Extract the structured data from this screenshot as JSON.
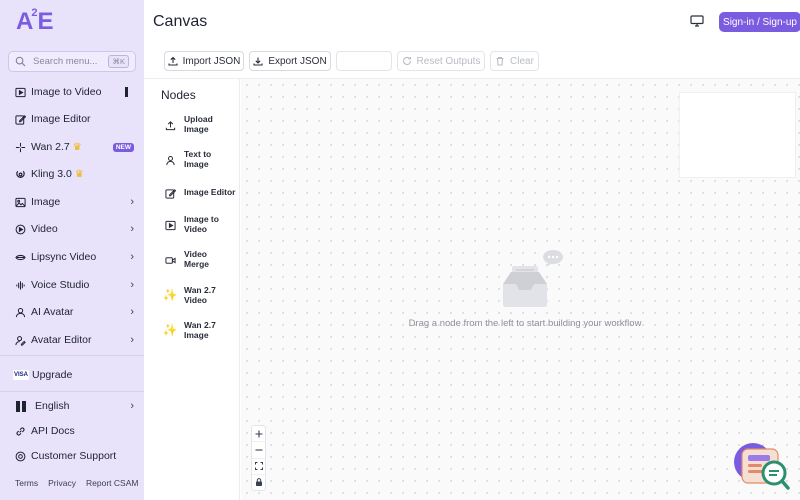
{
  "app": {
    "logo_text": "A",
    "logo_sup": "2",
    "logo_tail": "E",
    "page_title": "Canvas",
    "sign_label": "Sign-in / Sign-up"
  },
  "search": {
    "placeholder": "Search menu...",
    "shortcut": "⌘K"
  },
  "sidebar": {
    "items": [
      {
        "label": "Image to Video",
        "icon": "image-to-video-icon"
      },
      {
        "label": "Image Editor",
        "icon": "edit-icon"
      },
      {
        "label": "Wan 2.7",
        "icon": "wan-icon",
        "badge": "NEW",
        "crown": true
      },
      {
        "label": "Kling 3.0",
        "icon": "kling-icon",
        "crown": true
      },
      {
        "label": "Image",
        "icon": "image-icon",
        "chevron": true
      },
      {
        "label": "Video",
        "icon": "video-icon",
        "chevron": true
      },
      {
        "label": "Lipsync Video",
        "icon": "lipsync-icon",
        "chevron": true
      },
      {
        "label": "Voice Studio",
        "icon": "voice-icon",
        "chevron": true
      },
      {
        "label": "AI Avatar",
        "icon": "avatar-icon",
        "chevron": true
      },
      {
        "label": "Avatar Editor",
        "icon": "avatar-editor-icon",
        "chevron": true
      }
    ],
    "upgrade": {
      "label": "Upgrade",
      "card_text": "VISA"
    },
    "language": {
      "label": "English"
    },
    "api_docs": {
      "label": "API Docs"
    },
    "support": {
      "label": "Customer Support"
    },
    "footer": [
      "Terms",
      "Privacy",
      "Report CSAM"
    ]
  },
  "toolbar": {
    "import_label": "Import JSON",
    "export_label": "Export JSON",
    "reset_label": "Reset Outputs",
    "clear_label": "Clear"
  },
  "nodes": {
    "title": "Nodes",
    "items": [
      {
        "line1": "Upload",
        "line2": "Image",
        "icon": "upload-icon"
      },
      {
        "line1": "Text to",
        "line2": "Image",
        "icon": "person-icon"
      },
      {
        "line1": "Image Editor",
        "line2": "",
        "icon": "edit-icon"
      },
      {
        "line1": "Image to",
        "line2": "Video",
        "icon": "image-video-icon"
      },
      {
        "line1": "Video",
        "line2": "Merge",
        "icon": "video-camera-icon"
      },
      {
        "line1": "Wan 2.7",
        "line2": "Video",
        "icon": "sparkle-icon"
      },
      {
        "line1": "Wan 2.7",
        "line2": "Image",
        "icon": "sparkle-icon"
      }
    ]
  },
  "canvas": {
    "empty_message": "Drag a node from the left to start building your workflow"
  },
  "colors": {
    "accent": "#7a5ce0",
    "sidebar_bg": "#e9e2fb",
    "crown": "#f0b400"
  }
}
